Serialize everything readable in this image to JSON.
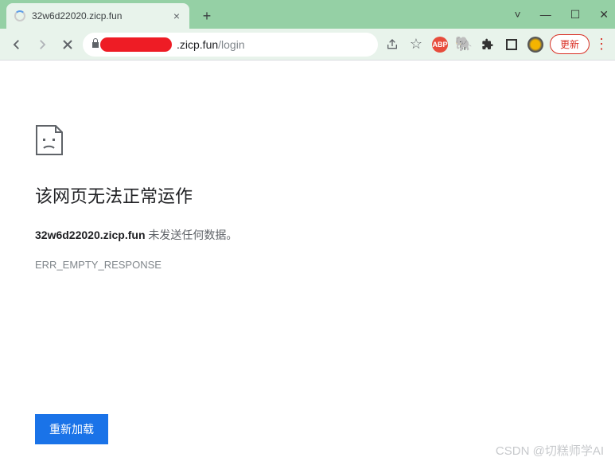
{
  "tab": {
    "title": "32w6d22020.zicp.fun",
    "close": "×"
  },
  "newtab": "+",
  "window": {
    "chev": "˅",
    "min": "—",
    "max": "☐",
    "close": "✕"
  },
  "address": {
    "visible_url": ".zicp.fun",
    "path": "/login",
    "share": "↗",
    "star": "☆",
    "adp": "ABP",
    "evernote": "🐘",
    "puzzle": "✦",
    "update": "更新",
    "menu": "⋮"
  },
  "page": {
    "heading": "该网页无法正常运作",
    "host": "32w6d22020.zicp.fun",
    "message": " 未发送任何数据。",
    "error_code": "ERR_EMPTY_RESPONSE",
    "reload": "重新加载"
  },
  "watermark": "CSDN @切糕师学AI"
}
